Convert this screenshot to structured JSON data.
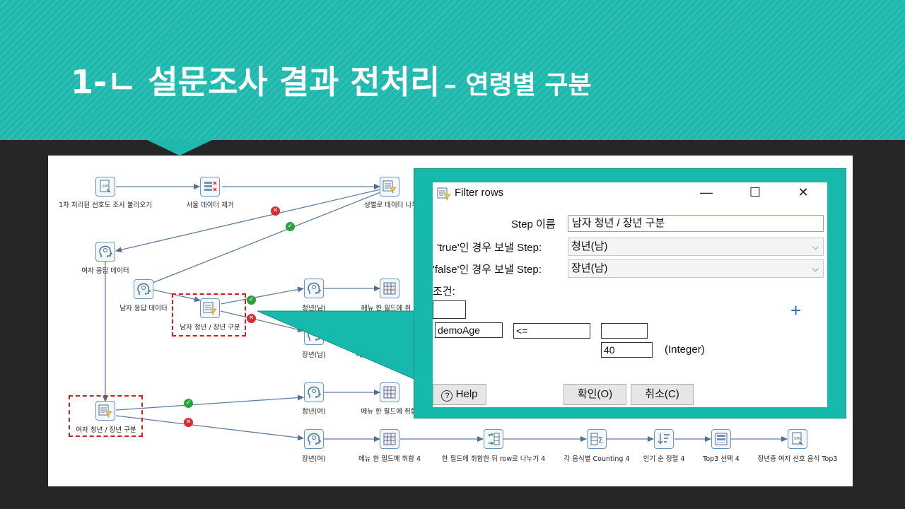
{
  "title": {
    "main": "1-ㄴ 설문조사 결과 전처리",
    "sub": "– 연령별 구분"
  },
  "steps": {
    "load": "1차 처리된 선호도 조사 불러오기",
    "remove_insincere": "서울 데이터 제거",
    "split_gender": "성별로 데이터 나누",
    "female_data": "여자 응답 데이터",
    "male_data": "남자 응답 데이터",
    "male_split": "남자 청년 / 장년 구분",
    "male_young": "청년(남)",
    "male_menu": "메뉴 한 필드에 취",
    "male_old": "장년(남)",
    "male_old_menu": "메",
    "female_split": "여자 청년 / 장년 구분",
    "female_young": "청년(여)",
    "female_young_menu": "메뉴 한 필드에 취합",
    "female_old": "장년(여)",
    "f_old_merge": "메뉴 한 필드에 취합 4",
    "f_old_split_rows": "한 필드에 취합한 뒤 row로 나누기 4",
    "f_old_count": "각 음식별 Counting 4",
    "f_old_sort": "인기 순 정렬 4",
    "f_old_top3": "Top3 선택 4",
    "f_old_output": "장년층 여자 선호 음식 Top3"
  },
  "dialog": {
    "title": "Filter rows",
    "minimize": "—",
    "maximize": "☐",
    "close": "✕",
    "step_name_label": "Step 이름",
    "step_name_value": "남자 청년 / 장년 구분",
    "true_label": "'true'인 경우 보낼 Step:",
    "true_value": "청년(남)",
    "false_label": "'false'인 경우 보낼 Step:",
    "false_value": "장년(남)",
    "condition_label": "조건:",
    "cond_field": "demoAge",
    "cond_op": "<=",
    "cond_value": "40",
    "cond_type": "(Integer)",
    "add": "+",
    "help_btn": "Help",
    "ok_btn": "확인(O)",
    "cancel_btn": "취소(C)"
  },
  "colors": {
    "teal": "#1fb8ad",
    "dark_bg": "#262626",
    "ok_badge": "#27a339",
    "fail_badge": "#d92b2b"
  }
}
